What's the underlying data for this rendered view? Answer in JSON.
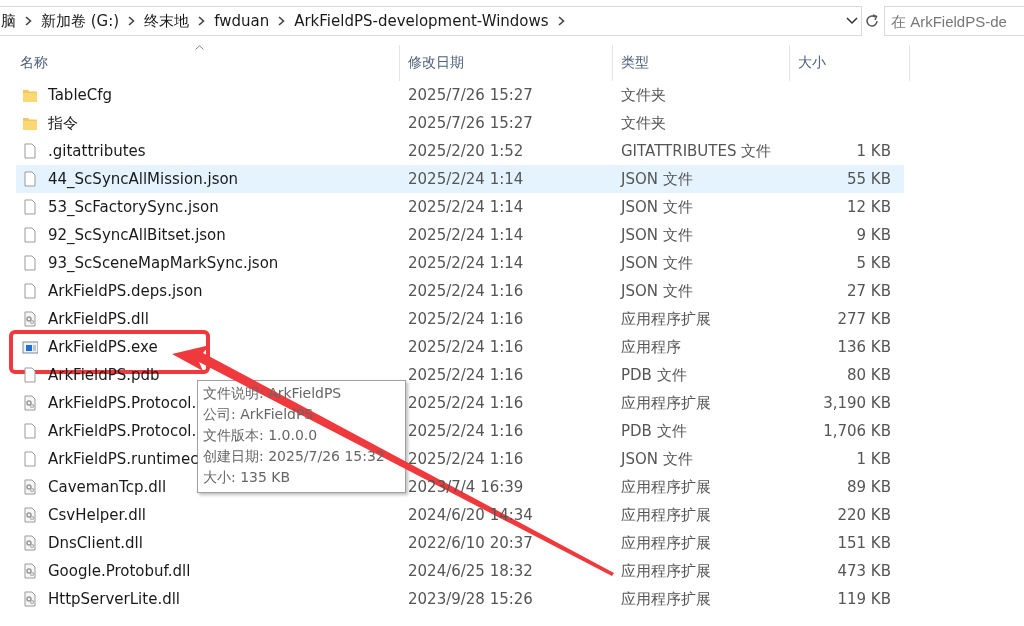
{
  "address_bar": {
    "path": [
      "脑",
      "新加卷 (G:)",
      "终末地",
      "fwduan",
      "ArkFieldPS-development-Windows"
    ]
  },
  "search": {
    "placeholder": "在 ArkFieldPS-de"
  },
  "table": {
    "columns": [
      {
        "label": "名称",
        "sorted": true
      },
      {
        "label": "修改日期",
        "sorted": false
      },
      {
        "label": "类型",
        "sorted": false
      },
      {
        "label": "大小",
        "sorted": false
      }
    ],
    "rows": [
      {
        "kind": "folder",
        "name": "TableCfg",
        "date": "2025/7/26 15:27",
        "type": "文件夹",
        "highlighted": false
      },
      {
        "kind": "folder",
        "name": "指令",
        "date": "2025/7/26 15:27",
        "type": "文件夹",
        "highlighted": false
      },
      {
        "kind": "file",
        "name": ".gitattributes",
        "date": "2025/2/20 1:52",
        "type": "GITATTRIBUTES 文件",
        "size": "1 KB",
        "highlighted": false
      },
      {
        "kind": "file",
        "name": "44_ScSyncAllMission.json",
        "date": "2025/2/24 1:14",
        "type": "JSON 文件",
        "size": "55 KB",
        "highlighted": true
      },
      {
        "kind": "file",
        "name": "53_ScFactorySync.json",
        "date": "2025/2/24 1:14",
        "type": "JSON 文件",
        "size": "12 KB",
        "highlighted": false
      },
      {
        "kind": "file",
        "name": "92_ScSyncAllBitset.json",
        "date": "2025/2/24 1:14",
        "type": "JSON 文件",
        "size": "9 KB",
        "highlighted": false
      },
      {
        "kind": "file",
        "name": "93_ScSceneMapMarkSync.json",
        "date": "2025/2/24 1:14",
        "type": "JSON 文件",
        "size": "5 KB",
        "highlighted": false
      },
      {
        "kind": "file",
        "name": "ArkFieldPS.deps.json",
        "date": "2025/2/24 1:16",
        "type": "JSON 文件",
        "size": "27 KB",
        "highlighted": false
      },
      {
        "kind": "dll",
        "name": "ArkFieldPS.dll",
        "date": "2025/2/24 1:16",
        "type": "应用程序扩展",
        "size": "277 KB",
        "highlighted": false
      },
      {
        "kind": "exe",
        "name": "ArkFieldPS.exe",
        "date": "2025/2/24 1:16",
        "type": "应用程序",
        "size": "136 KB",
        "highlighted": false
      },
      {
        "kind": "file",
        "name": "ArkFieldPS.pdb",
        "date": "2025/2/24 1:16",
        "type": "PDB 文件",
        "size": "80 KB",
        "highlighted": false
      },
      {
        "kind": "dll",
        "name": "ArkFieldPS.Protocol.",
        "date": "2025/2/24 1:16",
        "type": "应用程序扩展",
        "size": "3,190 KB",
        "highlighted": false
      },
      {
        "kind": "file",
        "name": "ArkFieldPS.Protocol.",
        "date": "2025/2/24 1:16",
        "type": "PDB 文件",
        "size": "1,706 KB",
        "highlighted": false
      },
      {
        "kind": "file",
        "name": "ArkFieldPS.runtimec",
        "date": "2025/2/24 1:16",
        "type": "JSON 文件",
        "size": "1 KB",
        "highlighted": false
      },
      {
        "kind": "dll",
        "name": "CavemanTcp.dll",
        "date": "2023/7/4 16:39",
        "type": "应用程序扩展",
        "size": "89 KB",
        "highlighted": false
      },
      {
        "kind": "dll",
        "name": "CsvHelper.dll",
        "date": "2024/6/20 14:34",
        "type": "应用程序扩展",
        "size": "220 KB",
        "highlighted": false
      },
      {
        "kind": "dll",
        "name": "DnsClient.dll",
        "date": "2022/6/10 20:37",
        "type": "应用程序扩展",
        "size": "151 KB",
        "highlighted": false
      },
      {
        "kind": "dll",
        "name": "Google.Protobuf.dll",
        "date": "2024/6/25 18:32",
        "type": "应用程序扩展",
        "size": "473 KB",
        "highlighted": false
      },
      {
        "kind": "dll",
        "name": "HttpServerLite.dll",
        "date": "2023/9/28 15:26",
        "type": "应用程序扩展",
        "size": "119 KB",
        "highlighted": false
      }
    ]
  },
  "tooltip": {
    "lines": [
      "文件说明: ArkFieldPS",
      "公司: ArkFieldPS",
      "文件版本: 1.0.0.0",
      "创建日期: 2025/7/26 15:32",
      "大小: 135 KB"
    ]
  }
}
